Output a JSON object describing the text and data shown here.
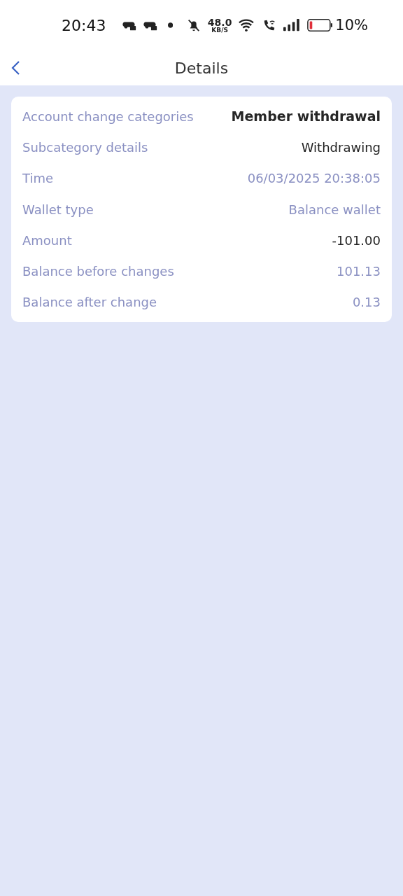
{
  "status_bar": {
    "time": "20:43",
    "speed": "48.0",
    "speed_unit": "KB/S",
    "battery": "10%"
  },
  "header": {
    "title": "Details"
  },
  "details": [
    {
      "label": "Account change categories",
      "value": "Member withdrawal",
      "kind": "emphasis"
    },
    {
      "label": "Subcategory details",
      "value": "Withdrawing",
      "kind": "plain"
    },
    {
      "label": "Time",
      "value": "06/03/2025 20:38:05",
      "kind": "muted"
    },
    {
      "label": "Wallet type",
      "value": "Balance wallet",
      "kind": "muted"
    },
    {
      "label": "Amount",
      "value": "-101.00",
      "kind": "plain"
    },
    {
      "label": "Balance before changes",
      "value": "101.13",
      "kind": "muted"
    },
    {
      "label": "Balance after change",
      "value": "0.13",
      "kind": "muted"
    }
  ]
}
